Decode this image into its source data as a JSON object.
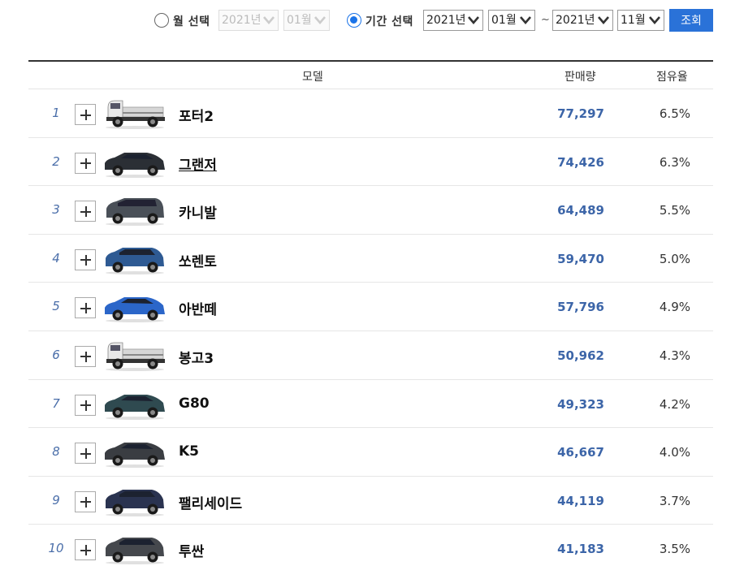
{
  "filter": {
    "month_option": {
      "label": "월 선택",
      "year": "2021년",
      "month": "01월",
      "checked": false
    },
    "period_option": {
      "label": "기간 선택",
      "from_year": "2021년",
      "from_month": "01월",
      "to_year": "2021년",
      "to_month": "11월",
      "checked": true
    },
    "separator": "~",
    "search_button": "조회"
  },
  "table": {
    "headers": {
      "model": "모델",
      "sales": "판매량",
      "share": "점유율"
    },
    "rows": [
      {
        "rank": "1",
        "model": "포터2",
        "sales": "77,297",
        "share": "6.5%",
        "car_type": "truck",
        "car_color": "#e8e8e8"
      },
      {
        "rank": "2",
        "model": "그랜저",
        "sales": "74,426",
        "share": "6.3%",
        "car_type": "sedan",
        "car_color": "#2b2f35"
      },
      {
        "rank": "3",
        "model": "카니발",
        "sales": "64,489",
        "share": "5.5%",
        "car_type": "van",
        "car_color": "#4a5058"
      },
      {
        "rank": "4",
        "model": "쏘렌토",
        "sales": "59,470",
        "share": "5.0%",
        "car_type": "suv",
        "car_color": "#2e5a93"
      },
      {
        "rank": "5",
        "model": "아반떼",
        "sales": "57,796",
        "share": "4.9%",
        "car_type": "sedan",
        "car_color": "#2b66c9"
      },
      {
        "rank": "6",
        "model": "봉고3",
        "sales": "50,962",
        "share": "4.3%",
        "car_type": "truck",
        "car_color": "#e8e8e8"
      },
      {
        "rank": "7",
        "model": "G80",
        "sales": "49,323",
        "share": "4.2%",
        "car_type": "sedan",
        "car_color": "#2f4a50"
      },
      {
        "rank": "8",
        "model": "K5",
        "sales": "46,667",
        "share": "4.0%",
        "car_type": "sedan",
        "car_color": "#3a3d42"
      },
      {
        "rank": "9",
        "model": "팰리세이드",
        "sales": "44,119",
        "share": "3.7%",
        "car_type": "suv",
        "car_color": "#2a3350"
      },
      {
        "rank": "10",
        "model": "투싼",
        "sales": "41,183",
        "share": "3.5%",
        "car_type": "suv",
        "car_color": "#45484d"
      }
    ]
  },
  "colors": {
    "accent": "#2a72d8",
    "sales_text": "#3c65a8",
    "rank_text": "#4a6ea9"
  }
}
